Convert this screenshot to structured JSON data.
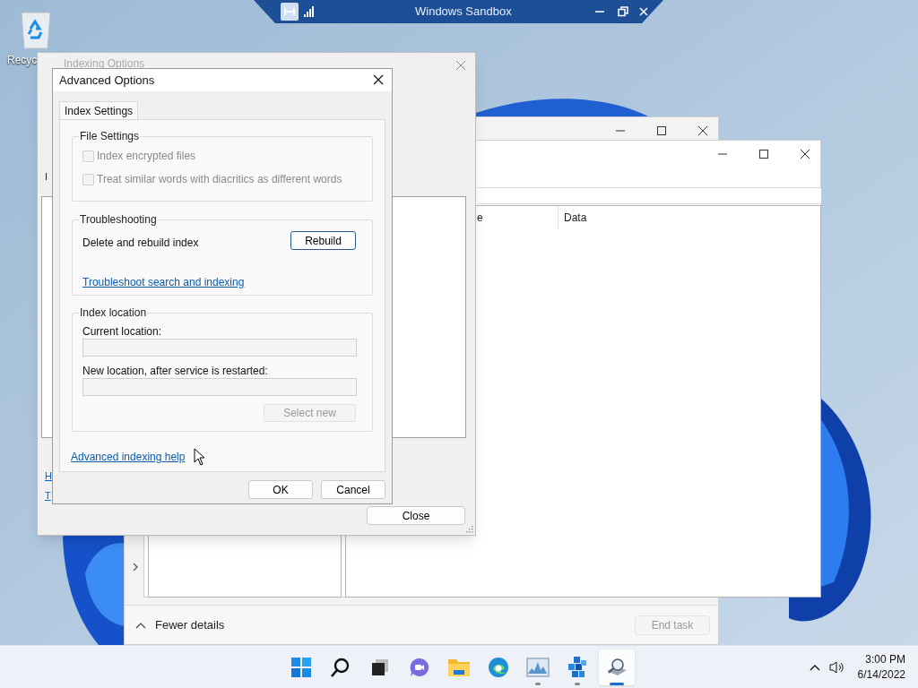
{
  "sandbox_bar": {
    "title": "Windows Sandbox"
  },
  "desktop_icons": [
    {
      "label": "Recyc"
    }
  ],
  "task_manager": {
    "footer_toggle": "Fewer details",
    "end_task": {
      "label": "End task",
      "disabled": true
    }
  },
  "registry_window": {
    "columns": [
      "e",
      "Data"
    ]
  },
  "indexing_options": {
    "title": "Indexing Options",
    "cut_texts": [
      {
        "text": "I",
        "kind": "text"
      },
      {
        "text": "H",
        "kind": "link"
      },
      {
        "text": "T",
        "kind": "link"
      }
    ],
    "close_button": "Close"
  },
  "advanced_options": {
    "title": "Advanced Options",
    "tabs": [
      {
        "label": "Index Settings",
        "selected": true
      }
    ],
    "file_settings": {
      "title": "File Settings",
      "checkboxes": [
        {
          "label": "Index encrypted files",
          "checked": false,
          "disabled": true
        },
        {
          "label": "Treat similar words with diacritics as different words",
          "checked": false,
          "disabled": true
        }
      ]
    },
    "troubleshooting": {
      "title": "Troubleshooting",
      "rebuild_label": "Delete and rebuild index",
      "rebuild_button": "Rebuild",
      "link": "Troubleshoot search and indexing"
    },
    "index_location": {
      "title": "Index location",
      "current_label": "Current location:",
      "new_label": "New location, after service is restarted:",
      "select_button": {
        "label": "Select new",
        "disabled": true
      }
    },
    "help_link": "Advanced indexing help",
    "buttons": [
      "OK",
      "Cancel"
    ]
  },
  "taskbar": {
    "apps": [
      {
        "kind": "start",
        "running": false,
        "selected": false
      },
      {
        "kind": "search",
        "running": false,
        "selected": false
      },
      {
        "kind": "taskview",
        "running": false,
        "selected": false
      },
      {
        "kind": "chat",
        "running": false,
        "selected": false
      },
      {
        "kind": "explorer",
        "running": false,
        "selected": false
      },
      {
        "kind": "edge",
        "running": false,
        "selected": false
      },
      {
        "kind": "perfmon",
        "running": true,
        "selected": false
      },
      {
        "kind": "cubes",
        "running": true,
        "selected": false
      },
      {
        "kind": "indexing",
        "running": true,
        "selected": true
      }
    ],
    "time": "3:00 PM",
    "date": "6/14/2022"
  }
}
